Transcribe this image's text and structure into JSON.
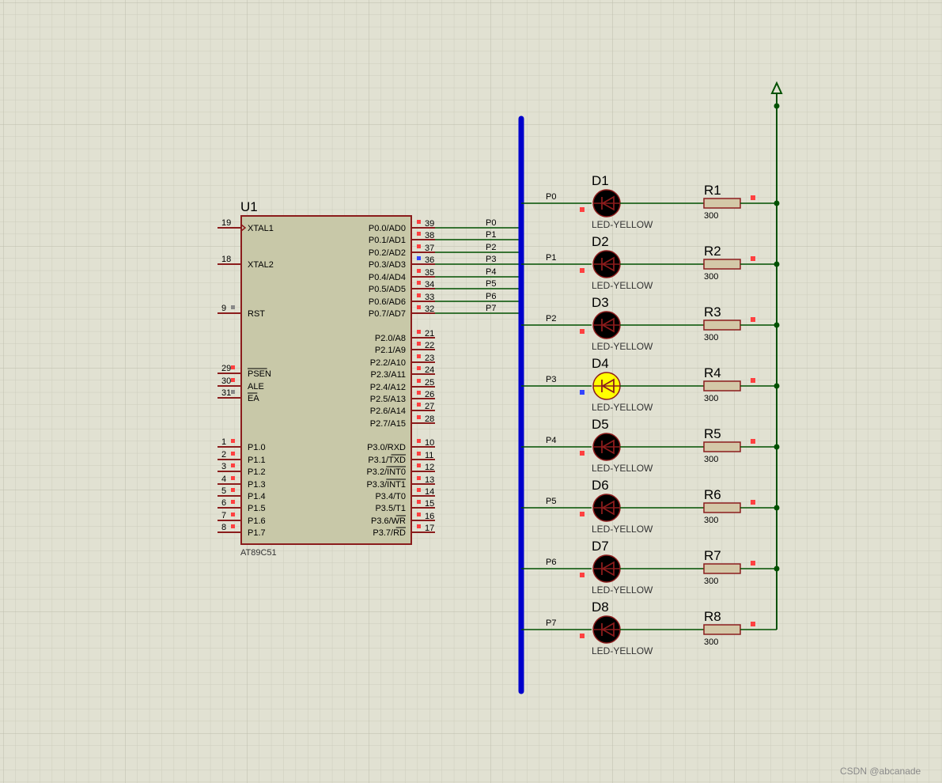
{
  "colors": {
    "background": "#e1e1d2",
    "grid_minor": "#cdcdbc",
    "grid_major": "#bdbdac",
    "wire": "#005000",
    "chip_body": "#c8c8a8",
    "chip_border": "#8b1c1c",
    "bus": "#0000cc",
    "led_off": "#000000",
    "led_on": "#ffff00",
    "led_outline": "#8b1c1c",
    "resistor_body": "#d4c8a8",
    "pin_marker_red": "#ff4040",
    "pin_marker_blue": "#3344ff",
    "pin_marker_gray": "#888888"
  },
  "chip": {
    "ref": "U1",
    "part": "AT89C51",
    "left_pins": [
      {
        "num": "19",
        "label": "XTAL1",
        "clock": true
      },
      {
        "num": "18",
        "label": "XTAL2"
      },
      {
        "num": "9",
        "label": "RST"
      },
      {
        "num": "29",
        "label": "PSEN",
        "overline": true
      },
      {
        "num": "30",
        "label": "ALE"
      },
      {
        "num": "31",
        "label": "EA",
        "overline": true
      },
      {
        "num": "1",
        "label": "P1.0"
      },
      {
        "num": "2",
        "label": "P1.1"
      },
      {
        "num": "3",
        "label": "P1.2"
      },
      {
        "num": "4",
        "label": "P1.3"
      },
      {
        "num": "5",
        "label": "P1.4"
      },
      {
        "num": "6",
        "label": "P1.5"
      },
      {
        "num": "7",
        "label": "P1.6"
      },
      {
        "num": "8",
        "label": "P1.7"
      }
    ],
    "right_pins": [
      {
        "num": "39",
        "label": "P0.0/AD0",
        "net": "P0"
      },
      {
        "num": "38",
        "label": "P0.1/AD1",
        "net": "P1"
      },
      {
        "num": "37",
        "label": "P0.2/AD2",
        "net": "P2"
      },
      {
        "num": "36",
        "label": "P0.3/AD3",
        "net": "P3"
      },
      {
        "num": "35",
        "label": "P0.4/AD4",
        "net": "P4"
      },
      {
        "num": "34",
        "label": "P0.5/AD5",
        "net": "P5"
      },
      {
        "num": "33",
        "label": "P0.6/AD6",
        "net": "P6"
      },
      {
        "num": "32",
        "label": "P0.7/AD7",
        "net": "P7"
      },
      {
        "num": "21",
        "label": "P2.0/A8"
      },
      {
        "num": "22",
        "label": "P2.1/A9"
      },
      {
        "num": "23",
        "label": "P2.2/A10"
      },
      {
        "num": "24",
        "label": "P2.3/A11"
      },
      {
        "num": "25",
        "label": "P2.4/A12"
      },
      {
        "num": "26",
        "label": "P2.5/A13"
      },
      {
        "num": "27",
        "label": "P2.6/A14"
      },
      {
        "num": "28",
        "label": "P2.7/A15"
      },
      {
        "num": "10",
        "label": "P3.0/RXD"
      },
      {
        "num": "11",
        "label": "P3.1/TXD",
        "overline_part": "TXD"
      },
      {
        "num": "12",
        "label": "P3.2/INT0",
        "overline_part": "INT0"
      },
      {
        "num": "13",
        "label": "P3.3/INT1",
        "overline_part": "INT1"
      },
      {
        "num": "14",
        "label": "P3.4/T0"
      },
      {
        "num": "15",
        "label": "P3.5/T1"
      },
      {
        "num": "16",
        "label": "P3.6/WR",
        "overline_part": "WR"
      },
      {
        "num": "17",
        "label": "P3.7/RD",
        "overline_part": "RD"
      }
    ]
  },
  "leds": [
    {
      "ref": "D1",
      "net": "P0",
      "type": "LED-YELLOW",
      "lit": false
    },
    {
      "ref": "D2",
      "net": "P1",
      "type": "LED-YELLOW",
      "lit": false
    },
    {
      "ref": "D3",
      "net": "P2",
      "type": "LED-YELLOW",
      "lit": false
    },
    {
      "ref": "D4",
      "net": "P3",
      "type": "LED-YELLOW",
      "lit": true
    },
    {
      "ref": "D5",
      "net": "P4",
      "type": "LED-YELLOW",
      "lit": false
    },
    {
      "ref": "D6",
      "net": "P5",
      "type": "LED-YELLOW",
      "lit": false
    },
    {
      "ref": "D7",
      "net": "P6",
      "type": "LED-YELLOW",
      "lit": false
    },
    {
      "ref": "D8",
      "net": "P7",
      "type": "LED-YELLOW",
      "lit": false
    }
  ],
  "resistors": [
    {
      "ref": "R1",
      "value": "300"
    },
    {
      "ref": "R2",
      "value": "300"
    },
    {
      "ref": "R3",
      "value": "300"
    },
    {
      "ref": "R4",
      "value": "300"
    },
    {
      "ref": "R5",
      "value": "300"
    },
    {
      "ref": "R6",
      "value": "300"
    },
    {
      "ref": "R7",
      "value": "300"
    },
    {
      "ref": "R8",
      "value": "300"
    }
  ],
  "power": {
    "symbol": "power-terminal-icon"
  },
  "watermark": "CSDN @abcanade"
}
